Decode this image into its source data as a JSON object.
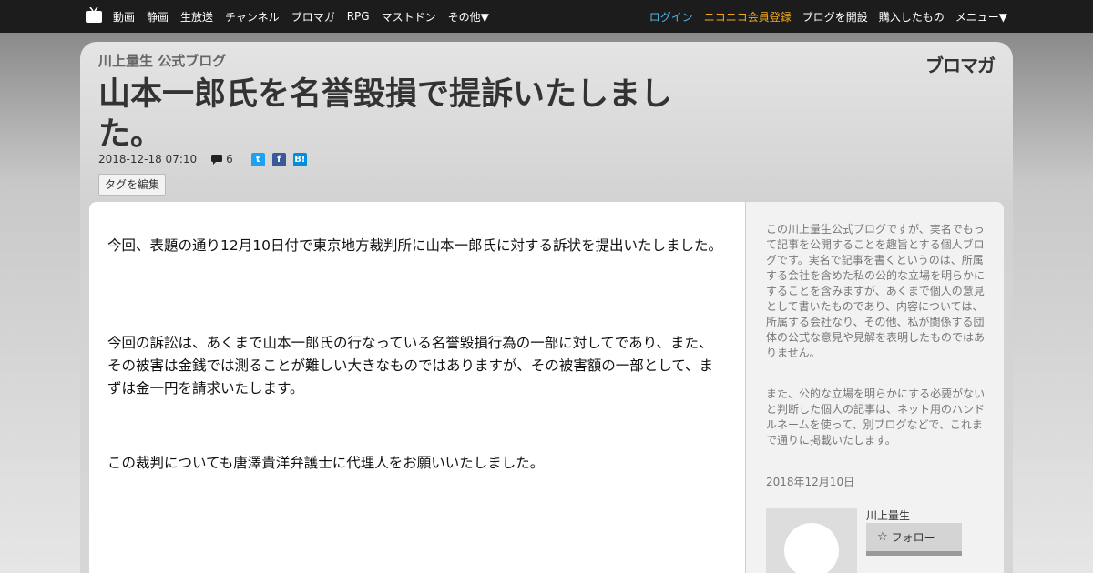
{
  "nav": {
    "left_items": [
      "動画",
      "静画",
      "生放送",
      "チャンネル",
      "ブロマガ",
      "RPG",
      "マストドン",
      "その他▼"
    ],
    "right_items": [
      {
        "label": "ログイン",
        "color": "#4fb7e6"
      },
      {
        "label": "ニコニコ会員登録",
        "color": "#f2a81d"
      },
      {
        "label": "ブログを開設",
        "color": "#ffffff"
      },
      {
        "label": "購入したもの",
        "color": "#ffffff"
      },
      {
        "label": "メニュー▼",
        "color": "#ffffff"
      }
    ]
  },
  "header": {
    "blog_name": "川上量生 公式ブログ",
    "logo": "ブロマガ",
    "title": "山本一郎氏を名誉毀損で提訴いたしました。",
    "date": "2018-12-18 07:10",
    "comment_count": "6",
    "share_twitter": "t",
    "share_facebook": "f",
    "share_hatena": "B!",
    "tag_button": "タグを編集"
  },
  "article": {
    "paragraphs": [
      "今回、表題の通り12月10日付で東京地方裁判所に山本一郎氏に対する訴状を提出いたしました。",
      "今回の訴訟は、あくまで山本一郎氏の行なっている名誉毀損行為の一部に対してであり、また、その被害は金銭では測ることが難しい大きなものではありますが、その被害額の一部として、まずは金一円を請求いたします。",
      "この裁判についても唐澤貴洋弁護士に代理人をお願いいたしました。"
    ]
  },
  "sidebar": {
    "description": "この川上量生公式ブログですが、実名でもって記事を公開することを趣旨とする個人ブログです。実名で記事を書くというのは、所属する会社を含めた私の公的な立場を明らかにすることを含みますが、あくまで個人の意見として書いたものであり、内容については、所属する会社なり、その他、私が関係する団体の公式な意見や見解を表明したものではありません。",
    "note": "また、公的な立場を明らかにする必要がないと判断した個人の記事は、ネット用のハンドルネームを使って、別ブログなどで、これまで通りに掲載いたします。",
    "date": "2018年12月10日",
    "author": "川上量生",
    "follow_label": "フォロー"
  }
}
